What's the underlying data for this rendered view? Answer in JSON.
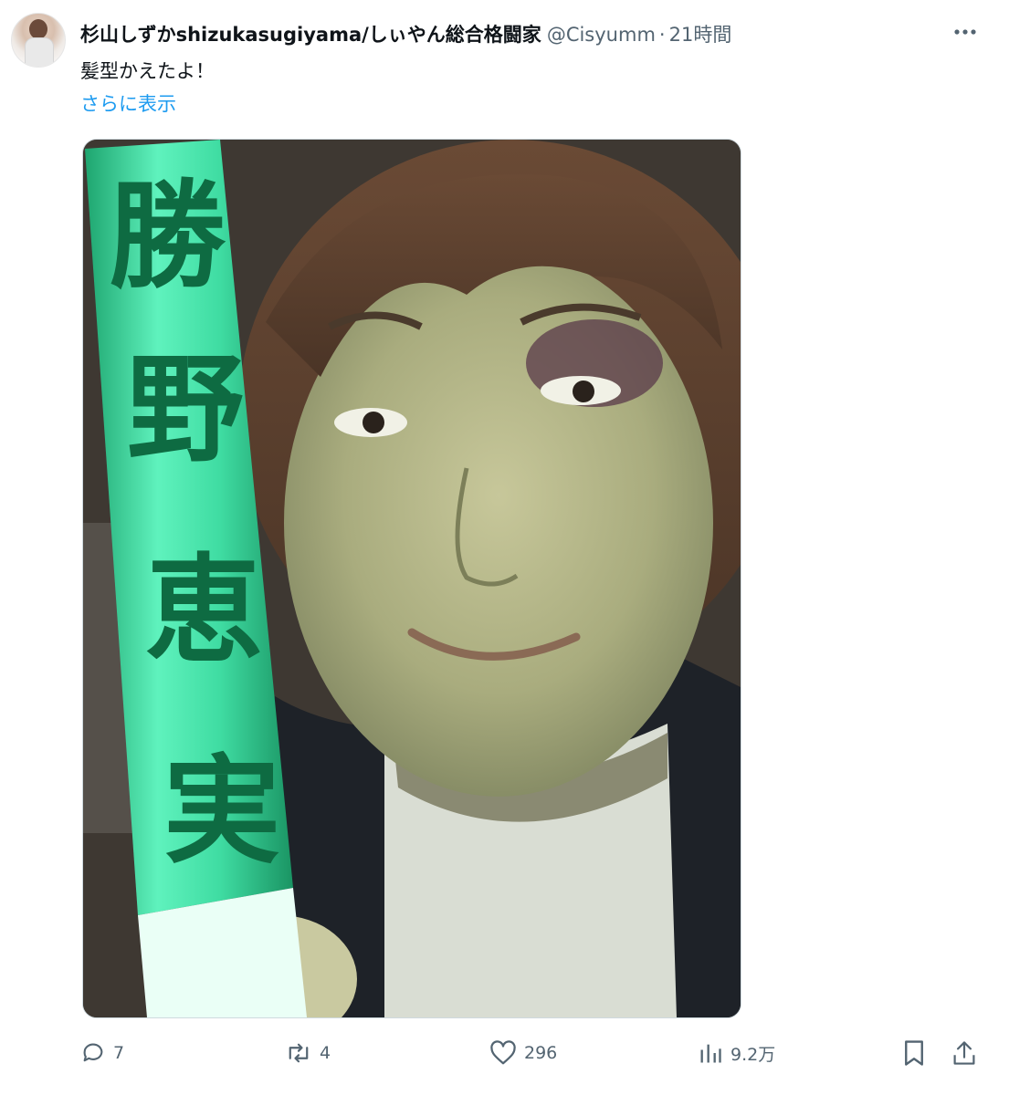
{
  "author": {
    "display_name": "杉山しずかshizukasugiyama/しぃやん総合格闘家",
    "handle": "@Cisyumm",
    "separator": "·",
    "time": "21時間"
  },
  "tweet": {
    "text": "髪型かえたよ！",
    "show_more": "さらに表示"
  },
  "media": {
    "glowstick_text": "勝野恵実"
  },
  "actions": {
    "reply_count": "7",
    "retweet_count": "4",
    "like_count": "296",
    "views_count": "9.2万"
  },
  "colors": {
    "link": "#1d9bf0",
    "secondary_text": "#536471",
    "primary_text": "#0f1419",
    "glowstick": "#35e6a0"
  },
  "icons": [
    "avatar",
    "more-icon",
    "reply-icon",
    "retweet-icon",
    "like-icon",
    "views-icon",
    "bookmark-icon",
    "share-icon"
  ]
}
